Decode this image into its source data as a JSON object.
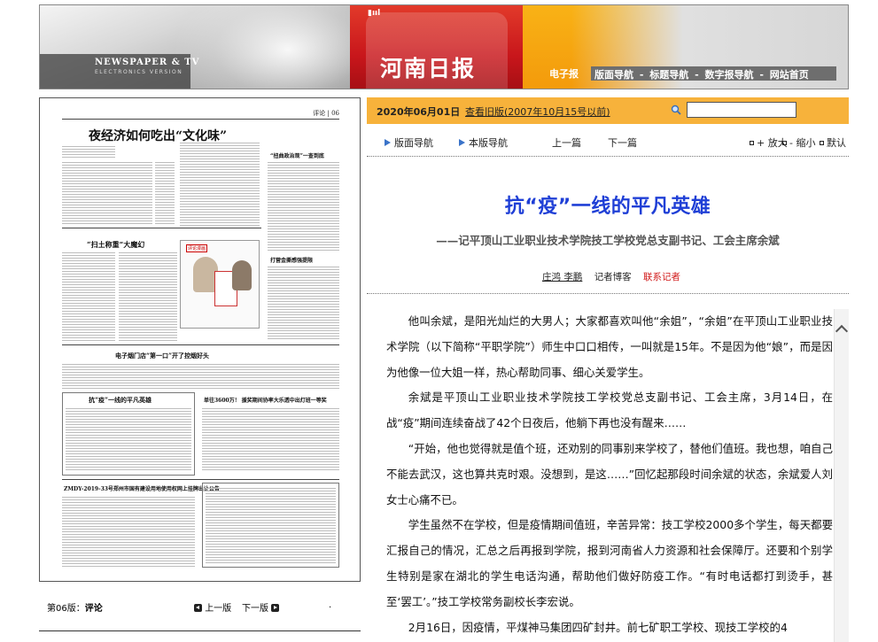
{
  "header": {
    "brand_en": "NEWSPAPER & TV",
    "brand_en_sub": "ELECTRONICS VERSION",
    "paper_name": "河南日报",
    "logo_mark": "▮ııl",
    "section": "电子报",
    "nav": [
      {
        "label": "版面导航"
      },
      {
        "label": "标题导航"
      },
      {
        "label": "数字报导航"
      },
      {
        "label": "网站首页"
      }
    ],
    "nav_sep": "-"
  },
  "newspaper_page": {
    "page_label": "评论 | 06",
    "headline_main": "夜经济如何吃出“文化味”",
    "headline_2": "“扫土称重”大魔幻",
    "headline_3": "电子烟门店“第一口”开了控烟好头",
    "headline_4": "抗“疫”一线的平凡英雄",
    "headline_5": "单往3600万！ 援奖期间协率大乐透中出灯班一等奖",
    "headline_6": "“扭曲政治观”一查到底",
    "headline_7": "打营金撕感强提限",
    "headline_8": "ZMDY-2019-33号郑州市国有建设用地使用权网上挂牌出让公告",
    "cartoon_label": "评论漫画"
  },
  "page_footer": {
    "page_no": "第06版：",
    "page_name": "评论",
    "prev": "上一版",
    "next": "下一版",
    "dot": "."
  },
  "date_bar": {
    "date": "2020年06月01日",
    "old_link": "查看旧版(2007年10月15号以前)",
    "search_value": ""
  },
  "toolbar": {
    "layout_nav": "版面导航",
    "this_nav": "本版导航",
    "prev": "上一篇",
    "next": "下一篇",
    "zoom_in": "+ 放大",
    "zoom_out": "- 缩小",
    "default": "默认"
  },
  "article": {
    "title": "抗“疫”一线的平凡英雄",
    "subtitle": "——记平顶山工业职业技术学院技工学校党总支副书记、工会主席余斌",
    "author": "庄鸿 李鹏",
    "blog": "记者博客",
    "contact": "联系记者",
    "paragraphs": [
      "他叫余斌，是阳光灿烂的大男人；大家都喜欢叫他“余姐”，“余姐”在平顶山工业职业技术学院（以下简称“平职学院”）师生中口口相传，一叫就是15年。不是因为他“娘”，而是因为他像一位大姐一样，热心帮助同事、细心关爱学生。",
      "余斌是平顶山工业职业技术学院技工学校党总支副书记、工会主席，3月14日，在战“疫”期间连续奋战了42个日夜后，他躺下再也没有醒来……",
      "“开始，他也觉得就是值个班，还劝别的同事别来学校了，替他们值班。我也想，咱自己不能去武汉，这也算共克时艰。没想到，是这……”回忆起那段时间余斌的状态，余斌爱人刘女士心痛不已。",
      "学生虽然不在学校，但是疫情期间值班，辛苦异常：技工学校2000多个学生，每天都要汇报自己的情况，汇总之后再报到学院，报到河南省人力资源和社会保障厅。还要和个别学生特别是家在湖北的学生电话沟通，帮助他们做好防疫工作。“有时电话都打到烫手，甚至‘罢工’。”技工学校常务副校长李宏说。",
      "2月16日，因疫情，平煤神马集团四矿封井。前七矿职工学校、现技工学校的4"
    ]
  },
  "colors": {
    "title_blue": "#1f3fd6",
    "date_bar_orange": "#f7b23b",
    "header_red": "#c8161b",
    "contact_red": "#d11a1a",
    "arrow_blue": "#3a73c9"
  }
}
